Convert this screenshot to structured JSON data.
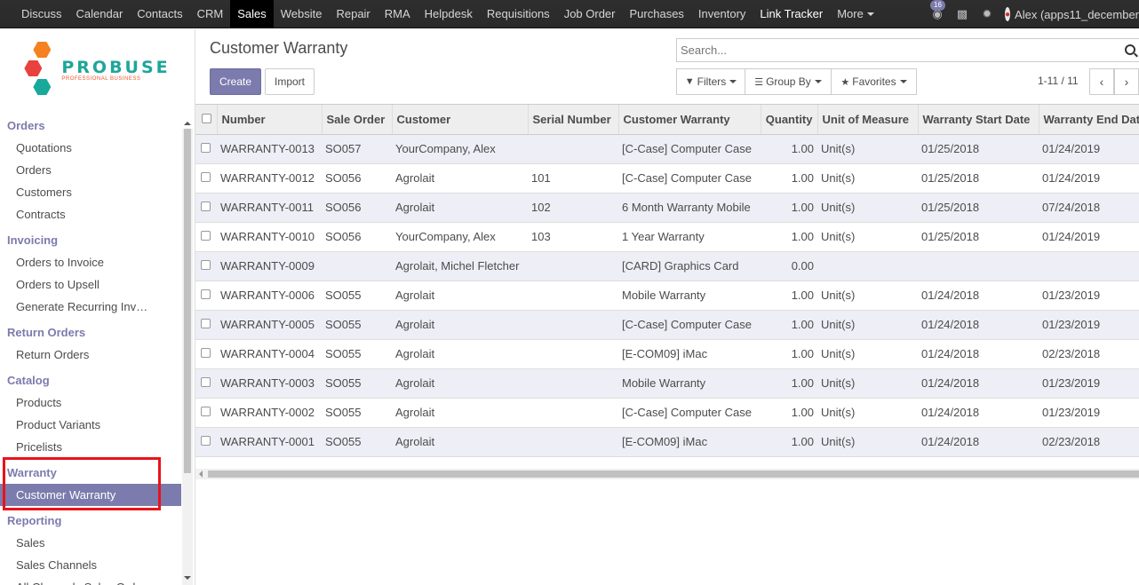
{
  "topnav": {
    "items": [
      {
        "label": "Discuss"
      },
      {
        "label": "Calendar"
      },
      {
        "label": "Contacts"
      },
      {
        "label": "CRM"
      },
      {
        "label": "Sales",
        "active": true
      },
      {
        "label": "Website"
      },
      {
        "label": "Repair"
      },
      {
        "label": "RMA"
      },
      {
        "label": "Helpdesk"
      },
      {
        "label": "Requisitions"
      },
      {
        "label": "Job Order"
      },
      {
        "label": "Purchases"
      },
      {
        "label": "Inventory"
      },
      {
        "label": "Link Tracker",
        "bright": true
      }
    ],
    "more_label": "More",
    "messages_badge": "16",
    "user_label": "Alex (apps11_december"
  },
  "logo": {
    "title": "PROBUSE",
    "subtitle": "PROFESSIONAL BUSINESS"
  },
  "sidebar": [
    {
      "section": "Orders",
      "items": [
        "Quotations",
        "Orders",
        "Customers",
        "Contracts"
      ]
    },
    {
      "section": "Invoicing",
      "items": [
        "Orders to Invoice",
        "Orders to Upsell",
        "Generate Recurring Inv…"
      ]
    },
    {
      "section": "Return Orders",
      "items": [
        "Return Orders"
      ]
    },
    {
      "section": "Catalog",
      "items": [
        "Products",
        "Product Variants",
        "Pricelists"
      ]
    },
    {
      "section": "Warranty",
      "items": [
        "Customer Warranty"
      ],
      "active_item": "Customer Warranty"
    },
    {
      "section": "Reporting",
      "items": [
        "Sales",
        "Sales Channels",
        "All Channels Sales Orders"
      ]
    }
  ],
  "page": {
    "title": "Customer Warranty",
    "create_label": "Create",
    "import_label": "Import",
    "search_placeholder": "Search...",
    "filters_label": "Filters",
    "groupby_label": "Group By",
    "favorites_label": "Favorites",
    "pager": "1-11 / 11"
  },
  "table": {
    "columns": [
      "Number",
      "Sale Order",
      "Customer",
      "Serial Number",
      "Customer Warranty",
      "Quantity",
      "Unit of Measure",
      "Warranty Start Date",
      "Warranty End Date"
    ],
    "rows": [
      [
        "WARRANTY-0013",
        "SO057",
        "YourCompany, Alex",
        "",
        "[C-Case] Computer Case",
        "1.00",
        "Unit(s)",
        "01/25/2018",
        "01/24/2019"
      ],
      [
        "WARRANTY-0012",
        "SO056",
        "Agrolait",
        "101",
        "[C-Case] Computer Case",
        "1.00",
        "Unit(s)",
        "01/25/2018",
        "01/24/2019"
      ],
      [
        "WARRANTY-0011",
        "SO056",
        "Agrolait",
        "102",
        "6 Month Warranty Mobile",
        "1.00",
        "Unit(s)",
        "01/25/2018",
        "07/24/2018"
      ],
      [
        "WARRANTY-0010",
        "SO056",
        "YourCompany, Alex",
        "103",
        "1 Year Warranty",
        "1.00",
        "Unit(s)",
        "01/25/2018",
        "01/24/2019"
      ],
      [
        "WARRANTY-0009",
        "",
        "Agrolait, Michel Fletcher",
        "",
        "[CARD] Graphics Card",
        "0.00",
        "",
        "",
        ""
      ],
      [
        "WARRANTY-0006",
        "SO055",
        "Agrolait",
        "",
        "Mobile Warranty",
        "1.00",
        "Unit(s)",
        "01/24/2018",
        "01/23/2019"
      ],
      [
        "WARRANTY-0005",
        "SO055",
        "Agrolait",
        "",
        "[C-Case] Computer Case",
        "1.00",
        "Unit(s)",
        "01/24/2018",
        "01/23/2019"
      ],
      [
        "WARRANTY-0004",
        "SO055",
        "Agrolait",
        "",
        "[E-COM09] iMac",
        "1.00",
        "Unit(s)",
        "01/24/2018",
        "02/23/2018"
      ],
      [
        "WARRANTY-0003",
        "SO055",
        "Agrolait",
        "",
        "Mobile Warranty",
        "1.00",
        "Unit(s)",
        "01/24/2018",
        "01/23/2019"
      ],
      [
        "WARRANTY-0002",
        "SO055",
        "Agrolait",
        "",
        "[C-Case] Computer Case",
        "1.00",
        "Unit(s)",
        "01/24/2018",
        "01/23/2019"
      ],
      [
        "WARRANTY-0001",
        "SO055",
        "Agrolait",
        "",
        "[E-COM09] iMac",
        "1.00",
        "Unit(s)",
        "01/24/2018",
        "02/23/2018"
      ]
    ]
  }
}
